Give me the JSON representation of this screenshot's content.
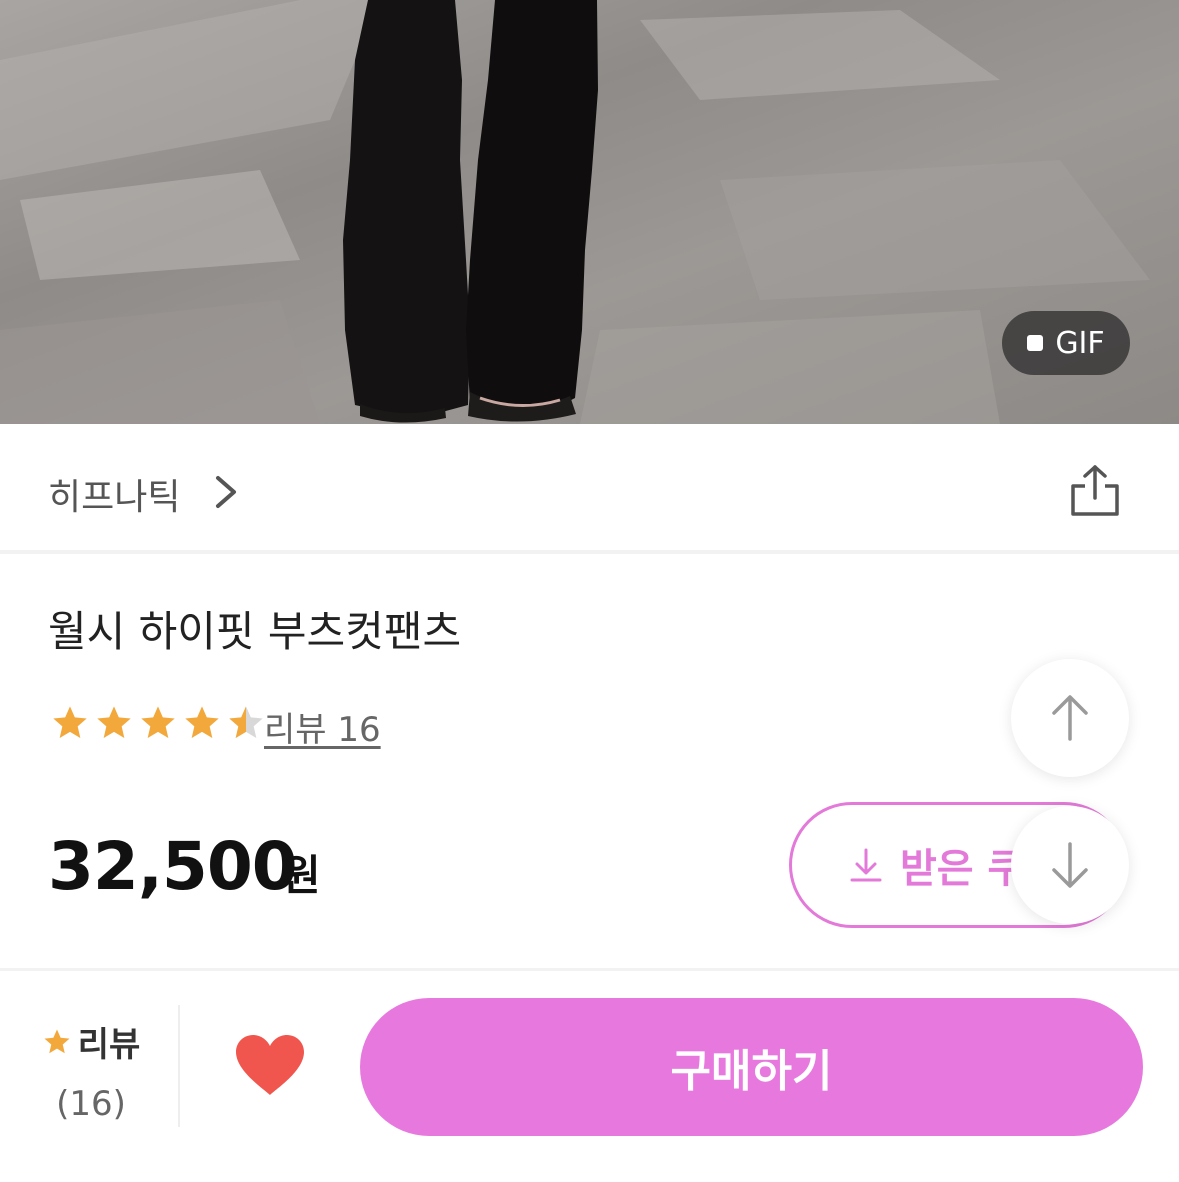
{
  "gallery": {
    "badge_label": "GIF"
  },
  "shop": {
    "name": "히프나틱"
  },
  "product": {
    "title": "월시 하이핏 부츠컷팬츠",
    "rating": 4.5,
    "rating_max": 5,
    "review_link_label": "리뷰 16",
    "price": "32,500",
    "price_unit": "원"
  },
  "coupon": {
    "label": "받은 쿠"
  },
  "bottom_bar": {
    "review_label": "리뷰",
    "review_count": "(16)",
    "buy_label": "구매하기"
  },
  "colors": {
    "accent": "#e779de",
    "star": "#f3a83b",
    "heart": "#f0564d"
  }
}
